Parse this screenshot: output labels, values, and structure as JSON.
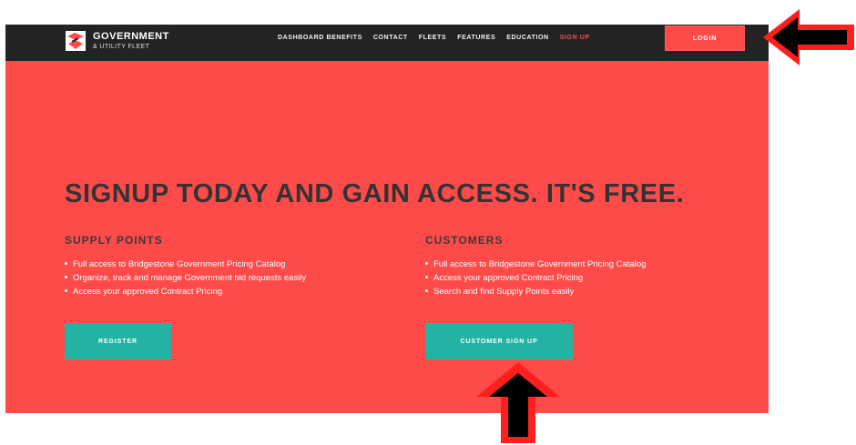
{
  "brand": {
    "title": "GOVERNMENT",
    "subtitle": "& UTILITY FLEET",
    "icon": "brand-logo-icon"
  },
  "nav": {
    "items": [
      {
        "label": "DASHBOARD BENEFITS"
      },
      {
        "label": "CONTACT"
      },
      {
        "label": "FLEETS"
      },
      {
        "label": "FEATURES"
      },
      {
        "label": "EDUCATION"
      },
      {
        "label": "SIGN UP",
        "active": true
      }
    ],
    "login_label": "LOGIN"
  },
  "hero": {
    "title": "SIGNUP TODAY AND GAIN ACCESS. IT'S FREE."
  },
  "supply_points": {
    "title": "SUPPLY POINTS",
    "bullets": [
      "Full access to Bridgestone Government Pricing Catalog",
      "Organize, track and manage Government bid requests easily",
      "Access your approved Contract Pricing"
    ],
    "button_label": "REGISTER"
  },
  "customers": {
    "title": "CUSTOMERS",
    "bullets": [
      "Full access to Bridgestone Government Pricing Catalog",
      "Access your approved Contract Pricing",
      "Search and find Supply Points easily"
    ],
    "button_label": "CUSTOMER SIGN UP"
  },
  "colors": {
    "page_red": "#ff4a4a",
    "topbar_dark": "#232323",
    "teal": "#22b3a3",
    "heading_dark": "#333333",
    "annotation_red": "#ff1f1f",
    "annotation_black": "#000000"
  },
  "annotations": {
    "arrow_right_icon": "left-pointing-arrow-icon",
    "arrow_up_icon": "up-pointing-arrow-icon"
  }
}
